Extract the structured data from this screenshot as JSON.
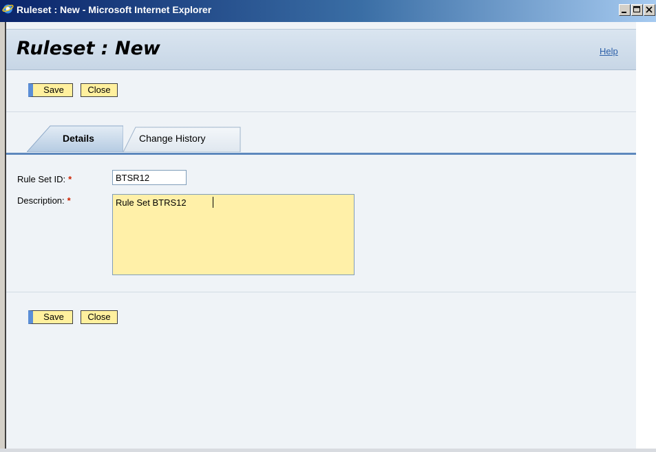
{
  "window": {
    "title": "Ruleset : New - Microsoft Internet Explorer"
  },
  "page": {
    "title": "Ruleset : New",
    "help_link": "Help"
  },
  "toolbar_top": {
    "save_label": "Save",
    "close_label": "Close"
  },
  "tabs": [
    {
      "label": "Details",
      "active": true
    },
    {
      "label": "Change History",
      "active": false
    }
  ],
  "form": {
    "rule_set_id": {
      "label": "Rule Set ID:",
      "required_marker": "*",
      "value": "BTSR12"
    },
    "description": {
      "label": "Description:",
      "required_marker": "*",
      "value": "Rule Set BTRS12"
    }
  },
  "toolbar_bottom": {
    "save_label": "Save",
    "close_label": "Close"
  },
  "colors": {
    "title_bar": "#0a246a",
    "header_bg": "#c7d6e6",
    "button_bg": "#fff09e",
    "save_accent": "#5b8ed7",
    "required": "#cc2200",
    "link": "#2c5fa8"
  }
}
